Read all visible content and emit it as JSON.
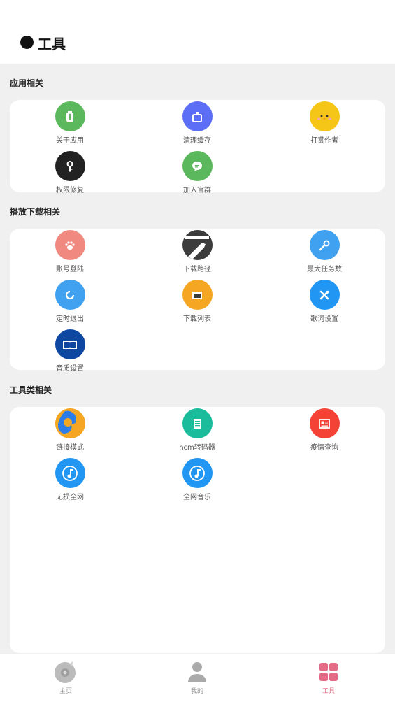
{
  "header": {
    "title": "工具"
  },
  "sections": [
    {
      "title": "应用相关",
      "items": [
        {
          "label": "关于应用",
          "icon": "app-info-icon",
          "color": "#5cb85c"
        },
        {
          "label": "清理缓存",
          "icon": "clean-cache-icon",
          "color": "#5b6ef5"
        },
        {
          "label": "打赏作者",
          "icon": "reward-chick-icon",
          "color": "#f5c518"
        },
        {
          "label": "权限修复",
          "icon": "key-icon",
          "color": "#222222"
        },
        {
          "label": "加入官群",
          "icon": "chat-bubble-icon",
          "color": "#5cb85c"
        }
      ]
    },
    {
      "title": "播放下载相关",
      "items": [
        {
          "label": "账号登陆",
          "icon": "paw-icon",
          "color": "#f08a80"
        },
        {
          "label": "下载路径",
          "icon": "folder-wrench-icon",
          "color": "#3c3c3c"
        },
        {
          "label": "最大任务数",
          "icon": "wrench-icon",
          "color": "#3fa1f0"
        },
        {
          "label": "定时退出",
          "icon": "refresh-icon",
          "color": "#3fa1f0"
        },
        {
          "label": "下载列表",
          "icon": "folder-icon",
          "color": "#f5a623"
        },
        {
          "label": "歌词设置",
          "icon": "tools-icon",
          "color": "#2196f3"
        },
        {
          "label": "音质设置",
          "icon": "dolby-icon",
          "color": "#0e47a1"
        }
      ]
    },
    {
      "title": "工具类相关",
      "items": [
        {
          "label": "链接模式",
          "icon": "firefox-icon",
          "color": "#f5a623"
        },
        {
          "label": "ncm转码器",
          "icon": "document-icon",
          "color": "#1abc9c"
        },
        {
          "label": "疫情查询",
          "icon": "newspaper-icon",
          "color": "#f44336"
        },
        {
          "label": "无损全网",
          "icon": "music-note-icon",
          "color": "#2196f3"
        },
        {
          "label": "全网音乐",
          "icon": "music-note-icon",
          "color": "#2196f3"
        }
      ]
    }
  ],
  "tabbar": {
    "tabs": [
      {
        "label": "主页",
        "icon": "disc-icon",
        "active": false
      },
      {
        "label": "我的",
        "icon": "user-icon",
        "active": false
      },
      {
        "label": "工具",
        "icon": "grid-icon",
        "active": true
      }
    ],
    "active_color": "#e46b85",
    "inactive_color": "#999999"
  }
}
